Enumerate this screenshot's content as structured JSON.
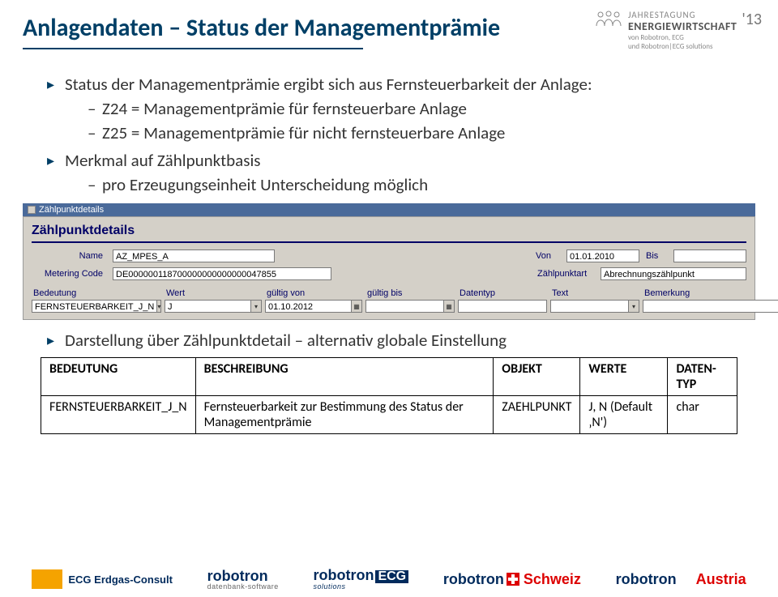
{
  "title": "Anlagendaten – Status der Managementprämie",
  "event": {
    "line1": "JAHRESTAGUNG",
    "line2": "ENERGIEWIRTSCHAFT",
    "line3": "von Robotron, ECG\nund Robotron|ECG solutions",
    "year": "'13"
  },
  "bullets": {
    "b1": "Status der Managementprämie ergibt sich aus Fernsteuerbarkeit der Anlage:",
    "b1a": "Z24 = Managementprämie für fernsteuerbare Anlage",
    "b1b": "Z25 = Managementprämie für nicht fernsteuerbare Anlage",
    "b2": "Merkmal auf Zählpunktbasis",
    "b2a": "pro Erzeugungseinheit Unterscheidung möglich",
    "b3": "Darstellung über Zählpunktdetail – alternativ globale Einstellung"
  },
  "app": {
    "window_title": "Zählpunktdetails",
    "section_title": "Zählpunktdetails",
    "labels": {
      "name": "Name",
      "von": "Von",
      "bis": "Bis",
      "metering": "Metering Code",
      "zptart": "Zählpunktart"
    },
    "fields": {
      "name_value": "AZ_MPES_A",
      "von_value": "01.01.2010",
      "bis_value": "",
      "metering_value": "DE000000118700000000000000047855",
      "zptart_value": "Abrechnungszählpunkt"
    },
    "grid_headers": {
      "bedeutung": "Bedeutung",
      "wert": "Wert",
      "gvon": "gültig von",
      "gbis": "gültig bis",
      "datentyp": "Datentyp",
      "bemerkung": "Bemerkung",
      "text": "Text"
    },
    "grid_row": {
      "bedeutung": "FERNSTEUERBARKEIT_J_N",
      "wert": "J",
      "gvon": "01.10.2012",
      "gbis": "",
      "datentyp": "",
      "text": "",
      "bemerkung": ""
    }
  },
  "defs_table": {
    "headers": {
      "h1": "BEDEUTUNG",
      "h2": "BESCHREIBUNG",
      "h3": "OBJEKT",
      "h4": "WERTE",
      "h5": "DATEN-TYP"
    },
    "row": {
      "c1": "FERNSTEUERBARKEIT_J_N",
      "c2": "Fernsteuerbarkeit zur Bestimmung des Status der Managementprämie",
      "c3": "ZAEHLPUNKT",
      "c4": "J, N (Default ‚N')",
      "c5": "char"
    }
  },
  "footer": {
    "ecg": "ECG Erdgas-Consult",
    "robotron": "robotron",
    "robotron_sub": "datenbank-software",
    "ecg_suffix": "ECG",
    "solutions": "solutions",
    "schweiz": "Schweiz",
    "austria": "Austria"
  }
}
